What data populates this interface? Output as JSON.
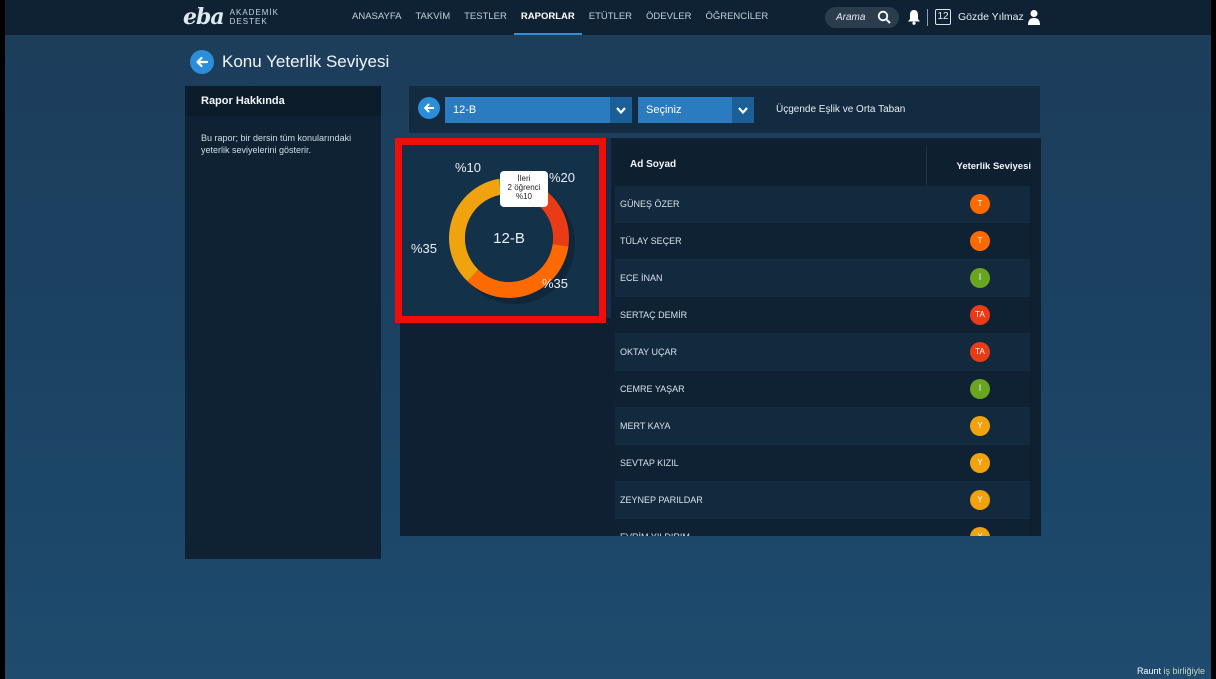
{
  "app": {
    "logo_main": "eba",
    "logo_sub_1": "AKADEMİK",
    "logo_sub_2": "DESTEK"
  },
  "nav": {
    "items": [
      {
        "label": "ANASAYFA",
        "active": false
      },
      {
        "label": "TAKVİM",
        "active": false
      },
      {
        "label": "TESTLER",
        "active": false
      },
      {
        "label": "RAPORLAR",
        "active": true
      },
      {
        "label": "ETÜTLER",
        "active": false
      },
      {
        "label": "ÖDEVLER",
        "active": false
      },
      {
        "label": "ÖĞRENCİLER",
        "active": false
      }
    ],
    "search_text": "Arama",
    "calendar_day": "12",
    "user_name": "Gözde Yılmaz"
  },
  "page": {
    "title": "Konu Yeterlik Seviyesi"
  },
  "about": {
    "heading": "Rapor Hakkında",
    "body": "Bu rapor; bir dersin tüm konularındaki yeterlik seviyelerini gösterir."
  },
  "filters": {
    "class_value": "12-B",
    "subject_value": "Seçiniz",
    "topic_label": "Üçgende Eşlik ve Orta Taban"
  },
  "chart_data": {
    "type": "pie",
    "center_label": "12-B",
    "slices": [
      {
        "label": "İleri",
        "value": 10,
        "display": "%10",
        "color": "#6aa521"
      },
      {
        "label": "",
        "value": 20,
        "display": "%20",
        "color": "#e83b16"
      },
      {
        "label": "",
        "value": 35,
        "display": "%35",
        "color": "#ff6a00"
      },
      {
        "label": "",
        "value": 35,
        "display": "%35",
        "color": "#f0a30e"
      }
    ],
    "tooltip": {
      "line1": "İleri",
      "line2": "2 öğrenci",
      "line3": "%10"
    }
  },
  "table": {
    "col_name": "Ad Soyad",
    "col_level": "Yeterlik Seviyesi",
    "rows": [
      {
        "name": "GÜNEŞ ÖZER",
        "level": "T",
        "color": "#ff6a00"
      },
      {
        "name": "TÜLAY SEÇER",
        "level": "T",
        "color": "#ff6a00"
      },
      {
        "name": "ECE İNAN",
        "level": "İ",
        "color": "#6aa521"
      },
      {
        "name": "SERTAÇ DEMİR",
        "level": "TA",
        "color": "#e83b16"
      },
      {
        "name": "OKTAY UÇAR",
        "level": "TA",
        "color": "#e83b16"
      },
      {
        "name": "CEMRE YAŞAR",
        "level": "İ",
        "color": "#6aa521"
      },
      {
        "name": "MERT KAYA",
        "level": "Y",
        "color": "#f0a30e"
      },
      {
        "name": "SEVTAP KIZIL",
        "level": "Y",
        "color": "#f0a30e"
      },
      {
        "name": "ZEYNEP PARILDAR",
        "level": "Y",
        "color": "#f0a30e"
      },
      {
        "name": "EVRİM YILDIRIM",
        "level": "Y",
        "color": "#f0a30e"
      }
    ]
  },
  "watermark": {
    "brand": "Raunt",
    "suffix": "iş birliğiyle"
  }
}
